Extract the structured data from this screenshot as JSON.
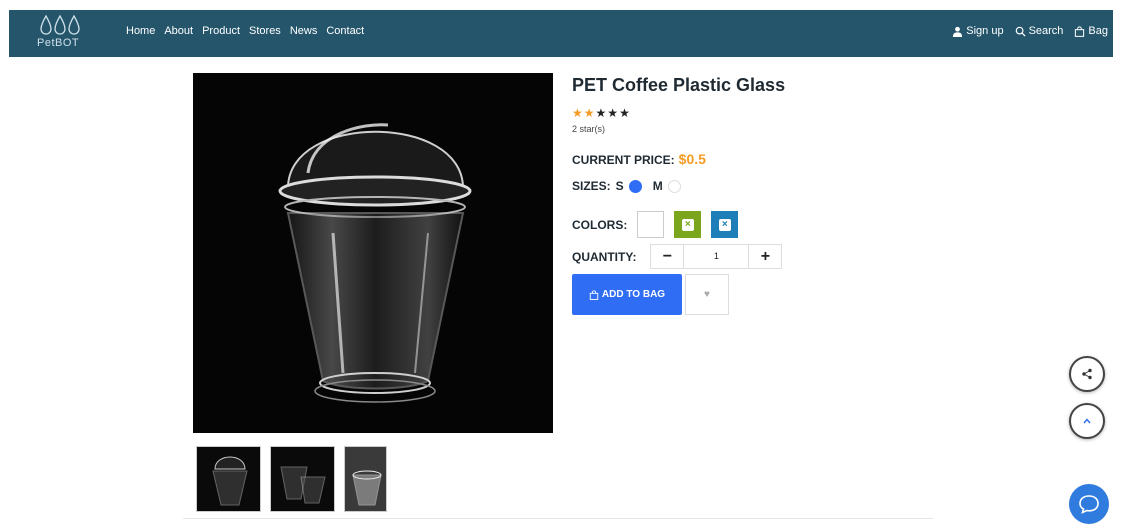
{
  "brand": {
    "name": "PetBOT"
  },
  "nav": {
    "links": [
      "Home",
      "About",
      "Product",
      "Stores",
      "News",
      "Contact"
    ],
    "right": [
      {
        "label": "Sign up",
        "icon": "user-icon"
      },
      {
        "label": "Search",
        "icon": "search-icon"
      },
      {
        "label": "Bag",
        "icon": "bag-icon"
      }
    ]
  },
  "product": {
    "title": "PET Coffee Plastic Glass",
    "rating": {
      "value": 2,
      "max": 5,
      "text": "2 star(s)"
    },
    "price_label": "CURRENT PRICE:",
    "price_value": "$0.5",
    "sizes_label": "SIZES:",
    "sizes": [
      {
        "label": "S",
        "selected": true
      },
      {
        "label": "M",
        "selected": false
      }
    ],
    "colors_label": "COLORS:",
    "colors": [
      "#ffffff",
      "#7aa51c",
      "#1e7fb8"
    ],
    "quantity_label": "QUANTITY:",
    "quantity_value": "1",
    "add_to_bag_label": "ADD TO BAG",
    "thumb_count": 3
  },
  "colors": {
    "nav": "#24556b",
    "accent": "#2f6df5",
    "price": "#f59a23",
    "star": "#f59a23"
  }
}
